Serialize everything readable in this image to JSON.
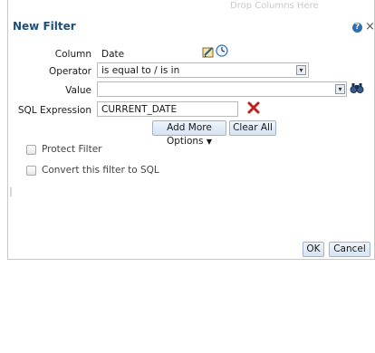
{
  "header": {
    "ghost_text": "Drop Columns Here"
  },
  "dialog": {
    "title": "New Filter",
    "help_icon": "help-icon",
    "close_icon": "close-icon",
    "close_glyph": "×",
    "help_glyph": "?"
  },
  "form": {
    "column_label": "Column",
    "column_value": "Date",
    "operator_label": "Operator",
    "operator_value": "is equal to / is in",
    "value_label": "Value",
    "value_value": "",
    "sql_label": "SQL Expression",
    "sql_value": "CURRENT_DATE"
  },
  "buttons": {
    "add_more_options": "Add More Options",
    "clear_all": "Clear All",
    "ok": "OK",
    "cancel": "Cancel"
  },
  "checkboxes": {
    "protect_filter": "Protect Filter",
    "convert_to_sql": "Convert this filter to SQL"
  },
  "colors": {
    "title": "#1f4e79",
    "button_border": "#9fb3cb",
    "delete_x": "#c0201c"
  }
}
